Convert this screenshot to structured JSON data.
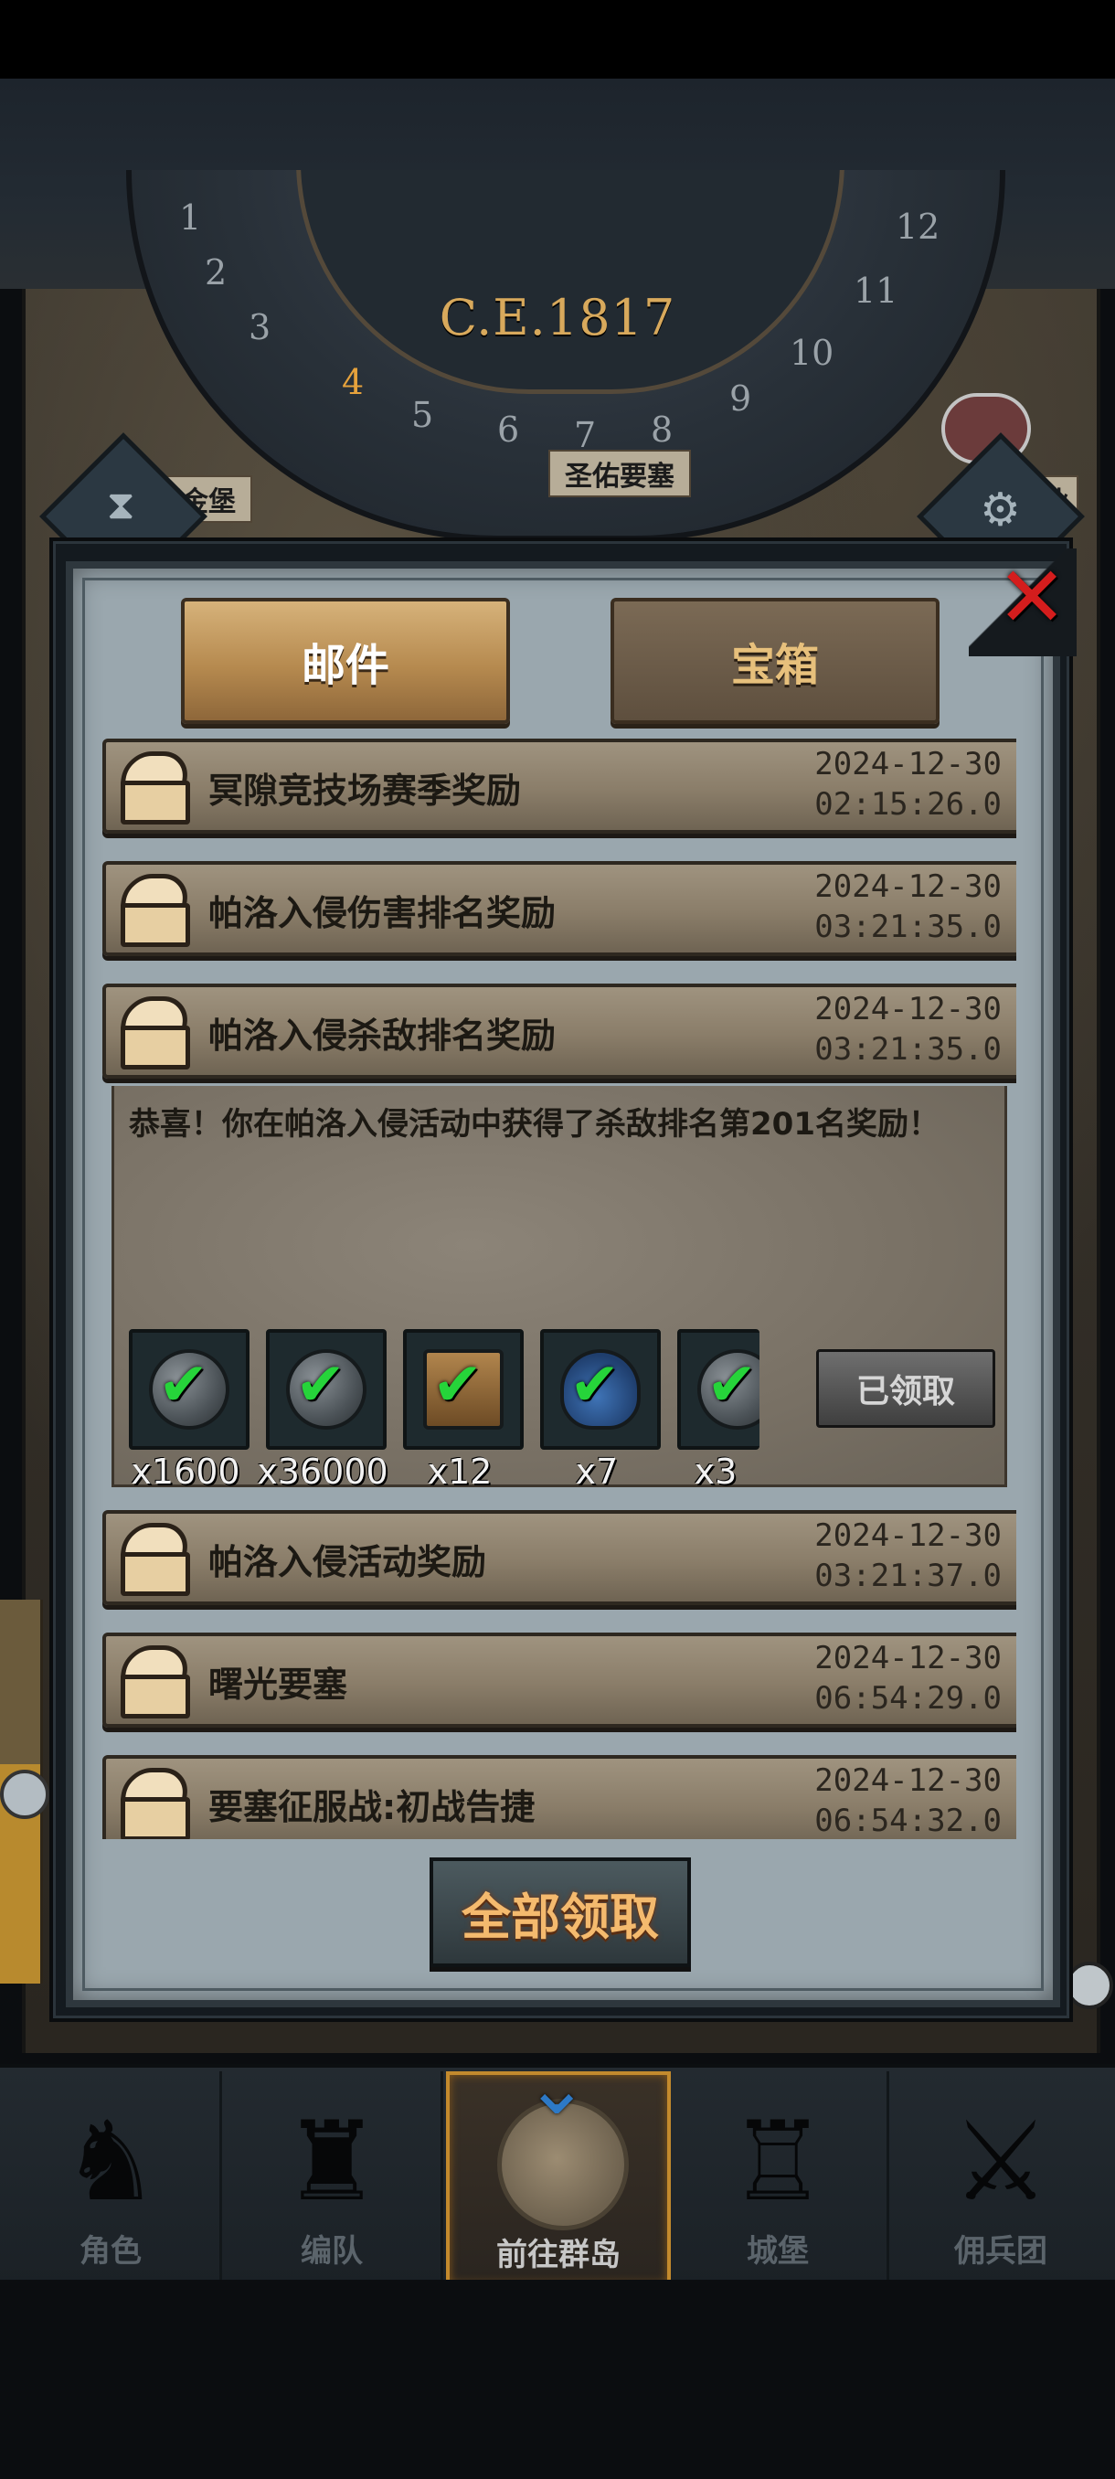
{
  "era": "C.E.1817",
  "dial": {
    "numbers": [
      "1",
      "2",
      "3",
      "4",
      "5",
      "6",
      "7",
      "8",
      "9",
      "10",
      "11",
      "12"
    ],
    "current": "4"
  },
  "map_labels": {
    "left": "耀金堡",
    "middle": "圣佑要塞",
    "right": "营业"
  },
  "tabs": [
    {
      "label": "邮件",
      "active": true
    },
    {
      "label": "宝箱",
      "active": false
    }
  ],
  "mails": [
    {
      "title": "冥隙竞技场赛季奖励",
      "date": "2024-12-30",
      "time": "02:15:26.0"
    },
    {
      "title": "帕洛入侵伤害排名奖励",
      "date": "2024-12-30",
      "time": "03:21:35.0"
    },
    {
      "title": "帕洛入侵杀敌排名奖励",
      "date": "2024-12-30",
      "time": "03:21:35.0",
      "expanded": true
    },
    {
      "title": "帕洛入侵活动奖励",
      "date": "2024-12-30",
      "time": "03:21:37.0"
    },
    {
      "title": "曙光要塞",
      "date": "2024-12-30",
      "time": "06:54:29.0"
    },
    {
      "title": "要塞征服战:初战告捷",
      "date": "2024-12-30",
      "time": "06:54:32.0"
    }
  ],
  "detail": {
    "message": "恭喜！你在帕洛入侵活动中获得了杀敌排名第201名奖励！",
    "rewards": [
      {
        "icon": "coin-icon",
        "count": "x1600"
      },
      {
        "icon": "silver-coin-icon",
        "count": "x36000"
      },
      {
        "icon": "chest-bag-icon",
        "count": "x12"
      },
      {
        "icon": "potion-icon",
        "count": "x7"
      },
      {
        "icon": "gem-icon",
        "count": "x3"
      }
    ],
    "claimed_label": "已领取"
  },
  "claim_all_label": "全部领取",
  "nav": [
    {
      "label": "角色",
      "icon": "knight-icon"
    },
    {
      "label": "编队",
      "icon": "helmet-icon"
    },
    {
      "label": "前往群岛",
      "icon": "globe-icon",
      "active": true
    },
    {
      "label": "城堡",
      "icon": "castle-icon"
    },
    {
      "label": "佣兵团",
      "icon": "mercenary-icon"
    }
  ],
  "colors": {
    "accent_gold": "#d6b27a",
    "close_red": "#d41d1d",
    "check_green": "#26d43a",
    "claim_orange": "#f4ba6e"
  }
}
